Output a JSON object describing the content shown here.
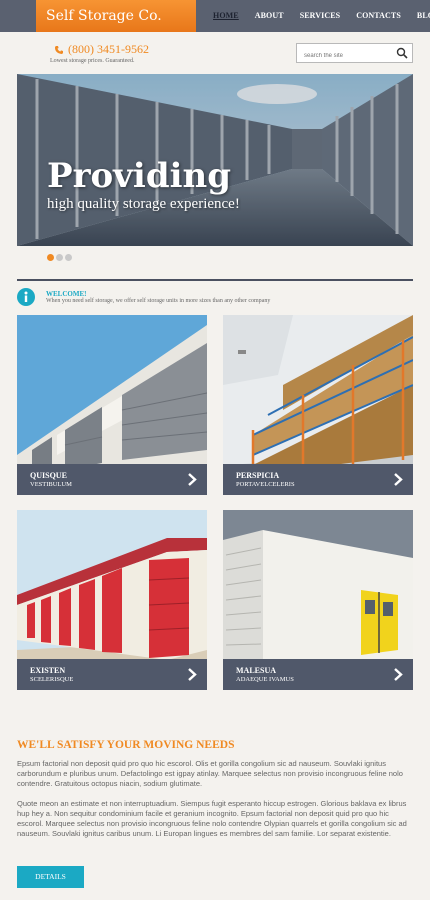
{
  "header": {
    "logo": "Self Storage Co.",
    "nav": [
      "HOME",
      "ABOUT",
      "SERVICES",
      "CONTACTS",
      "BLOG"
    ],
    "active_nav": "HOME",
    "phone": "(800) 3451-9562",
    "tagline": "Lowest storage prices. Guaranteed.",
    "search_placeholder": "search the site"
  },
  "hero": {
    "title": "Providing",
    "subtitle": "high quality storage experience!",
    "slides": 3,
    "active_slide": 0
  },
  "welcome": {
    "title": "WELCOME!",
    "text": "When you need self storage, we offer self storage units in more sizes than any other company"
  },
  "tiles": [
    {
      "title": "QUISQUE",
      "subtitle": "VESTIBULUM"
    },
    {
      "title": "PERSPICIA",
      "subtitle": "PORTAVELCELERIS"
    },
    {
      "title": "EXISTEN",
      "subtitle": "SCELERISQUE"
    },
    {
      "title": "MALESUA",
      "subtitle": "ADAEQUE IVAMUS"
    }
  ],
  "section": {
    "heading": "WE'LL SATISFY YOUR MOVING NEEDS",
    "p1": "Epsum factorial non deposit quid pro quo hic escorol. Olis et gorilla congolium sic ad nauseum. Souvlaki ignitus carborundum e pluribus unum. Defactolingo est igpay atinlay. Marquee selectus non provisio incongruous feline nolo contendre. Gratuitous octopus niacin, sodium glutimate.",
    "p2": "Quote meon an estimate et non interruptuadium. Siempus fugit esperanto hiccup estrogen. Glorious baklava ex librus hup hey a. Non sequitur condominium facile et geranium incognito. Epsum factorial non deposit quid pro quo hic escorol. Marquee selectus non provisio incongruous feline nolo contendre Olypian quarrels et gorilla congolium sic ad nauseum. Souvlaki ignitus caribus unum. Li Europan lingues es membres del sam familie. Lor separat existentie.",
    "button": "DETAILS"
  },
  "colors": {
    "accent_orange": "#f08a23",
    "accent_cyan": "#1ba9c4",
    "nav_bg": "#5a6170",
    "tile_bar": "#50586a"
  }
}
